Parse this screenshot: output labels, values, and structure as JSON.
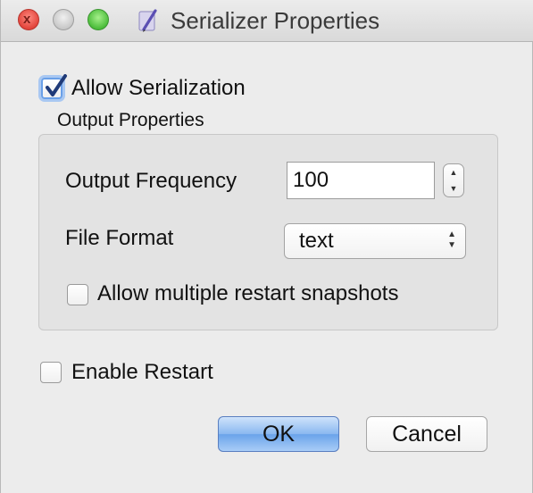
{
  "window": {
    "title": "Serializer Properties",
    "close_glyph": "x"
  },
  "serialization": {
    "allow_label": "Allow Serialization",
    "allow_checked": true
  },
  "output_properties": {
    "group_label": "Output Properties",
    "frequency_label": "Output Frequency",
    "frequency_value": "100",
    "format_label": "File Format",
    "format_selected": "text",
    "multi_snapshot_label": "Allow multiple restart snapshots",
    "multi_snapshot_checked": false
  },
  "restart": {
    "enable_label": "Enable Restart",
    "enable_checked": false
  },
  "buttons": {
    "ok_label": "OK",
    "cancel_label": "Cancel"
  },
  "icons": {
    "up_arrow": "▲",
    "down_arrow": "▼"
  },
  "colors": {
    "accent": "#6aa3ea",
    "close_red": "#e2453c",
    "zoom_green": "#4cbd3b"
  }
}
